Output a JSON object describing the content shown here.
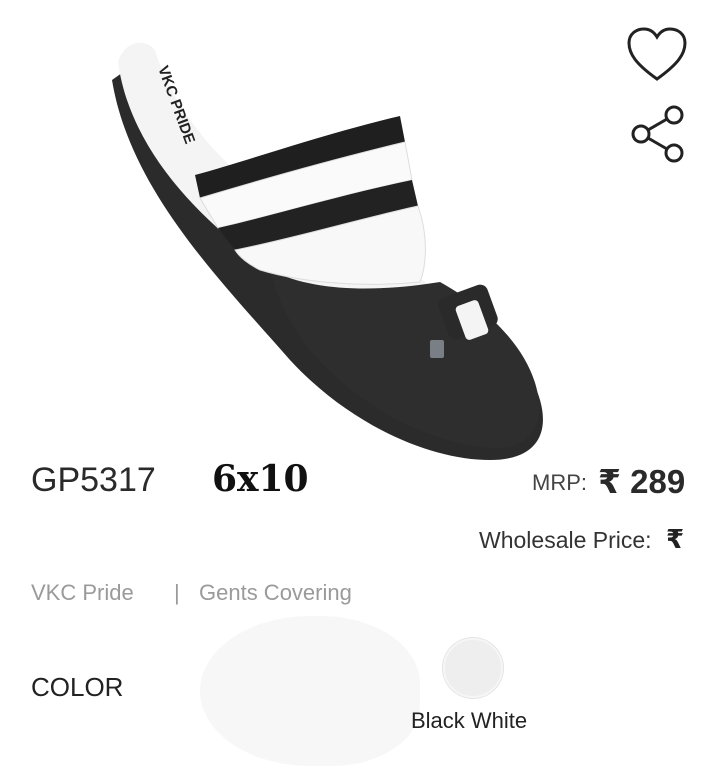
{
  "product": {
    "image_alt": "sandal-image",
    "code": "GP5317",
    "pack": "6x10",
    "mrp_label": "MRP:",
    "mrp_value": "₹ 289",
    "wholesale_label": "Wholesale Price:",
    "wholesale_currency": "₹",
    "brand": "VKC Pride",
    "separator": "|",
    "category": "Gents Covering"
  },
  "actions": {
    "wishlist_icon": "heart-icon",
    "share_icon": "share-icon"
  },
  "colors": {
    "heading": "COLOR",
    "options": [
      {
        "label": "Black White",
        "swatch": "#eeeeee"
      }
    ]
  }
}
